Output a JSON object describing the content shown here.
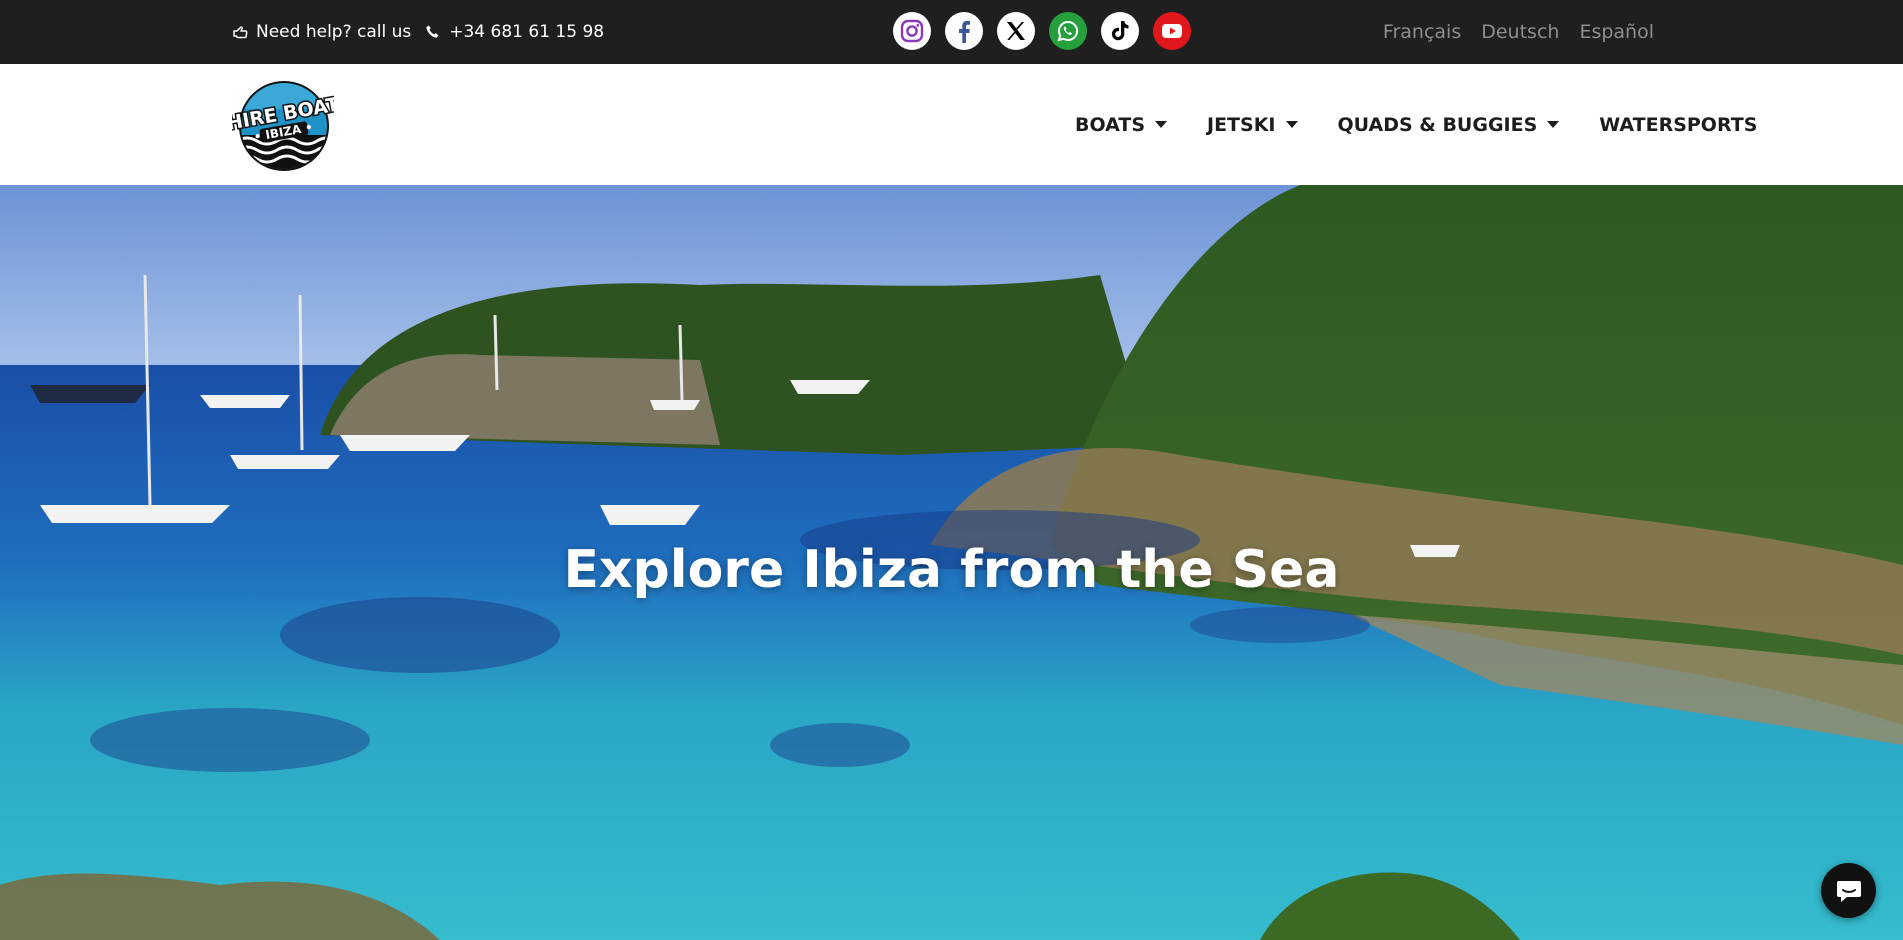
{
  "topbar": {
    "help_text": "Need help? call us",
    "phone": "+34 681 61 15 98",
    "social": [
      {
        "icon": "instagram-icon",
        "color": "#8a3ab9"
      },
      {
        "icon": "facebook-icon",
        "color": "#3b5998"
      },
      {
        "icon": "x-twitter-icon",
        "color": "#000000"
      },
      {
        "icon": "whatsapp-icon",
        "color": "#25a03c"
      },
      {
        "icon": "tiktok-icon",
        "color": "#000000"
      },
      {
        "icon": "youtube-icon",
        "color": "#e0171c"
      }
    ],
    "languages": [
      "Français",
      "Deutsch",
      "Español"
    ]
  },
  "header": {
    "logo_text_top": "HIRE BOAT",
    "logo_text_bottom": "IBIZA",
    "nav": [
      {
        "label": "BOATS",
        "has_dropdown": true
      },
      {
        "label": "JETSKI",
        "has_dropdown": true
      },
      {
        "label": "QUADS & BUGGIES",
        "has_dropdown": true
      },
      {
        "label": "WATERSPORTS",
        "has_dropdown": false
      }
    ]
  },
  "hero": {
    "title": "Explore Ibiza from the Sea"
  },
  "colors": {
    "topbar_bg": "#1f1f1f",
    "nav_text": "#1d1d1d",
    "lang_text": "#8e8e8e",
    "sea_deep": "#1a4fa8",
    "sea_turquoise": "#2fb3c9"
  }
}
